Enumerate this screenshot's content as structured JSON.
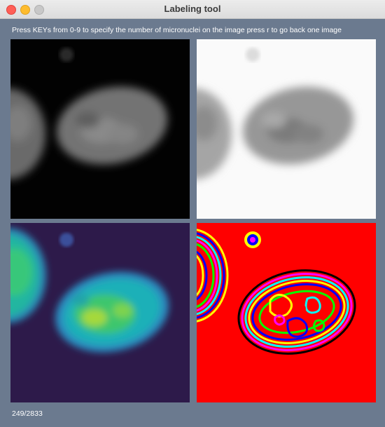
{
  "window": {
    "title": "Labeling tool"
  },
  "instruction": "Press KEYs from 0-9 to specify the number of micronuclei on the image press r to go back one image",
  "counter": "249/2833",
  "colors": {
    "background": "#6b7a8f",
    "close": "#ff5f57",
    "minimize": "#febc2e",
    "zoom": "#c8c8c8"
  },
  "panels": [
    {
      "name": "grayscale",
      "style": "gray on black"
    },
    {
      "name": "inverted",
      "style": "dark gray on white"
    },
    {
      "name": "viridis",
      "style": "viridis colormap"
    },
    {
      "name": "contour",
      "style": "rainbow contour on red"
    }
  ]
}
